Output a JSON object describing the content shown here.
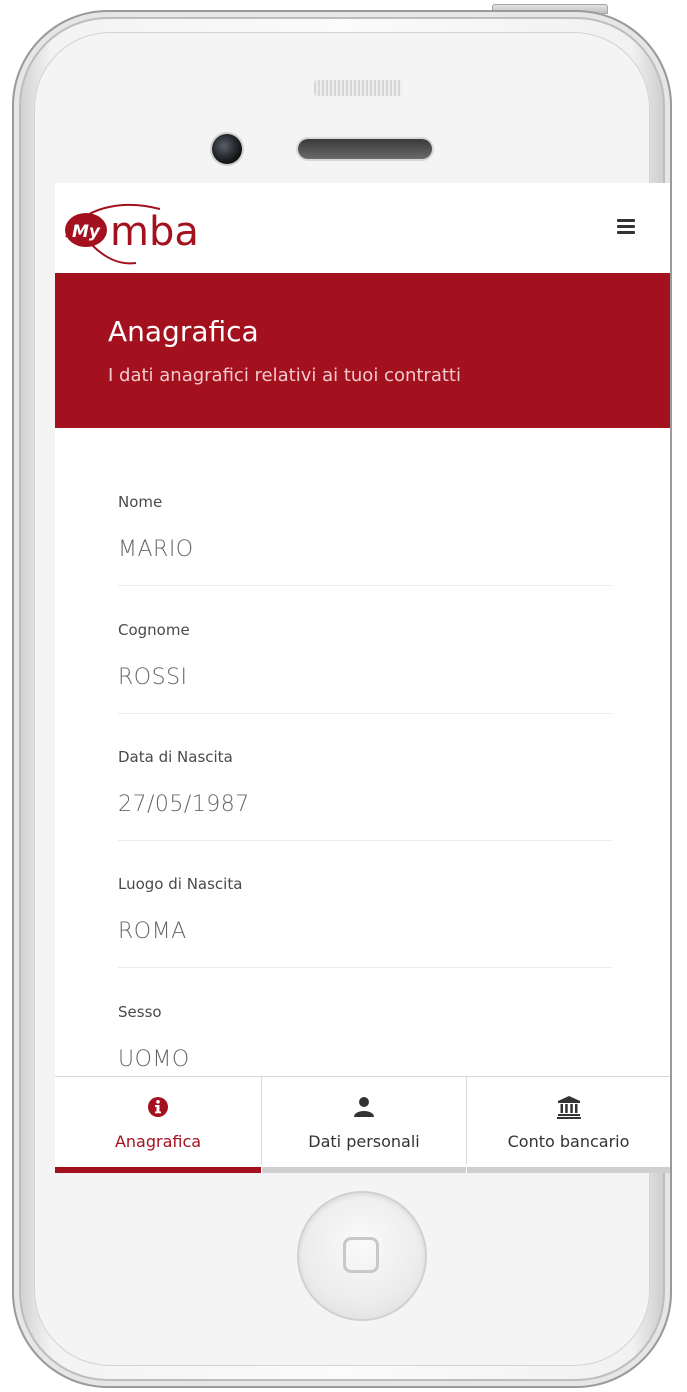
{
  "app": {
    "logo_text": "mba",
    "logo_badge": "My"
  },
  "banner": {
    "title": "Anagrafica",
    "subtitle": "I dati anagrafici relativi ai tuoi contratti"
  },
  "fields": [
    {
      "label": "Nome",
      "value": "MARIO"
    },
    {
      "label": "Cognome",
      "value": "ROSSI"
    },
    {
      "label": "Data di Nascita",
      "value": "27/05/1987"
    },
    {
      "label": "Luogo di Nascita",
      "value": "ROMA"
    },
    {
      "label": "Sesso",
      "value": "UOMO"
    }
  ],
  "tabs": [
    {
      "label": "Anagrafica",
      "icon": "info-circle-icon",
      "active": true
    },
    {
      "label": "Dati personali",
      "icon": "user-icon",
      "active": false
    },
    {
      "label": "Conto bancario",
      "icon": "bank-icon",
      "active": false
    }
  ],
  "colors": {
    "brand": "#a4111e",
    "banner_subtitle": "#f2c9cc",
    "inactive_tab_bar": "#cfcfcf"
  }
}
